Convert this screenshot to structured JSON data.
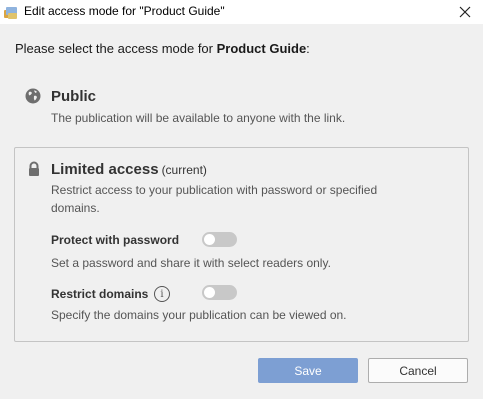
{
  "window": {
    "title": "Edit access mode for \"Product Guide\""
  },
  "prompt": {
    "prefix": "Please select the access mode for ",
    "publication": "Product Guide",
    "suffix": ":"
  },
  "public_option": {
    "icon": "globe-icon",
    "title": "Public",
    "description": "The publication will be available to anyone with the link."
  },
  "limited_option": {
    "icon": "lock-icon",
    "title": "Limited access",
    "current_tag": "(current)",
    "description_line1": "Restrict access to your publication with password or specified",
    "description_line2": "domains.",
    "password": {
      "label": "Protect with password",
      "enabled": false,
      "description": "Set a password and share it with select readers only."
    },
    "domains": {
      "label": "Restrict domains",
      "info_icon": "info-icon",
      "enabled": false,
      "description": "Specify the domains your publication can be viewed on."
    }
  },
  "buttons": {
    "save": "Save",
    "cancel": "Cancel"
  },
  "colors": {
    "save_button": "#7d9fd3",
    "toggle_off": "#c8c8c8",
    "background": "#f0f0f0"
  }
}
